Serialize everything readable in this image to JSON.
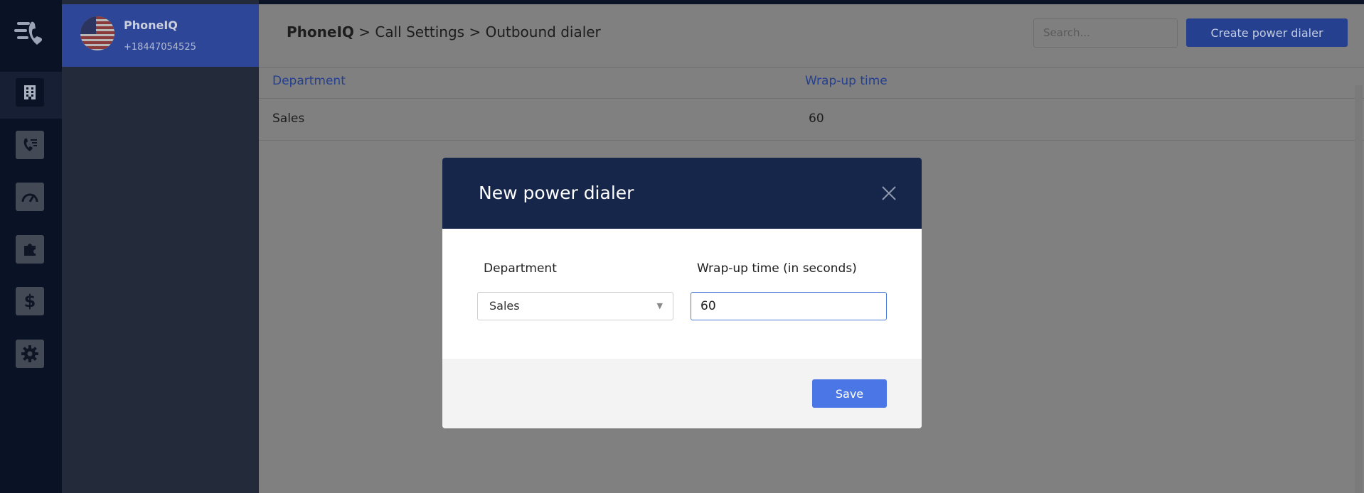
{
  "account": {
    "name": "PhoneIQ",
    "number": "+18447054525"
  },
  "breadcrumb": {
    "root": "PhoneIQ",
    "sep1": " > ",
    "level1": "Call Settings",
    "sep2": " > ",
    "level2": "Outbound dialer"
  },
  "header": {
    "search_placeholder": "Search...",
    "create_button": "Create power dialer"
  },
  "table": {
    "columns": [
      "Department",
      "Wrap-up time"
    ],
    "rows": [
      [
        "Sales",
        "60"
      ]
    ]
  },
  "sidebar": {
    "icons": [
      "company-building-icon",
      "phone-list-icon",
      "speedometer-icon",
      "puzzle-icon",
      "dollar-icon",
      "gear-icon"
    ]
  },
  "modal": {
    "title": "New power dialer",
    "department_label": "Department",
    "department_value": "Sales",
    "wrapup_label": "Wrap-up time (in seconds)",
    "wrapup_value": "60",
    "save_label": "Save"
  }
}
